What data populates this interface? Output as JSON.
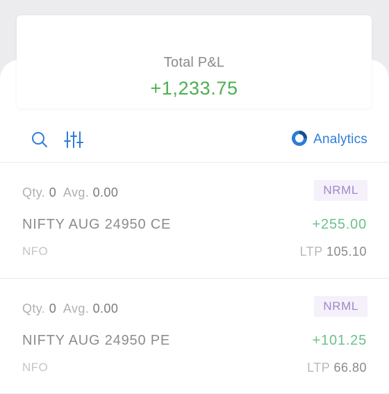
{
  "summary": {
    "label": "Total P&L",
    "value": "+1,233.75"
  },
  "toolbar": {
    "search_icon": "search-icon",
    "filter_icon": "sliders-icon",
    "analytics_label": "Analytics",
    "accent_color": "#2d7cd6"
  },
  "positions": [
    {
      "qty_label": "Qty.",
      "qty": "0",
      "avg_label": "Avg.",
      "avg": "0.00",
      "product": "NRML",
      "name": "NIFTY AUG 24950 CE",
      "pnl": "+255.00",
      "exchange": "NFO",
      "ltp_label": "LTP",
      "ltp": "105.10"
    },
    {
      "qty_label": "Qty.",
      "qty": "0",
      "avg_label": "Avg.",
      "avg": "0.00",
      "product": "NRML",
      "name": "NIFTY AUG 24950 PE",
      "pnl": "+101.25",
      "exchange": "NFO",
      "ltp_label": "LTP",
      "ltp": "66.80"
    }
  ]
}
